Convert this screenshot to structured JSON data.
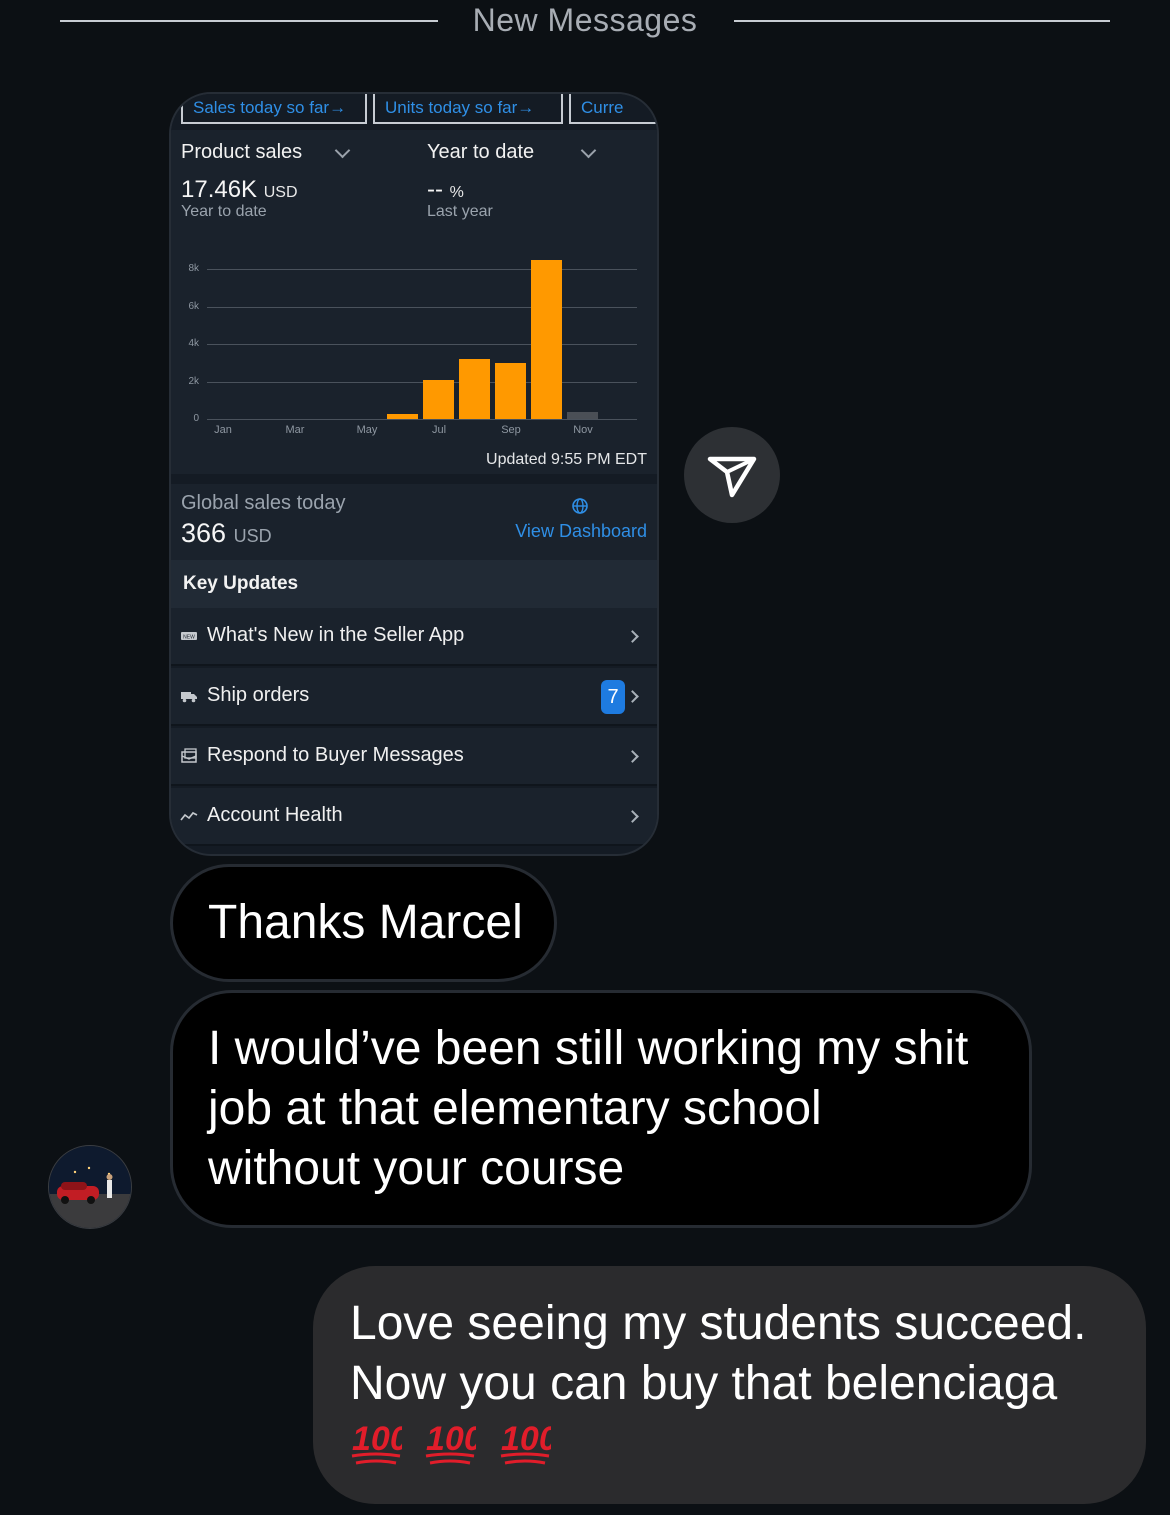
{
  "divider": {
    "label": "New Messages"
  },
  "screenshot": {
    "tabs": [
      "Sales today so far→",
      "Units today so far→",
      "Curre"
    ],
    "metric_selector": "Product sales",
    "period_selector": "Year to date",
    "total": {
      "value": "17.46K",
      "unit": "USD",
      "caption": "Year to date"
    },
    "change": {
      "value": "--",
      "unit": "%",
      "caption": "Last year"
    },
    "chart_data": {
      "type": "bar",
      "title": "",
      "xlabel": "",
      "ylabel": "",
      "ylim": [
        0,
        8000
      ],
      "yticks": [
        "0",
        "2k",
        "4k",
        "6k",
        "8k"
      ],
      "xticks": [
        "Jan",
        "Mar",
        "May",
        "Jul",
        "Sep",
        "Nov"
      ],
      "categories": [
        "Jan",
        "Feb",
        "Mar",
        "Apr",
        "May",
        "Jun",
        "Jul",
        "Aug",
        "Sep",
        "Oct",
        "Nov",
        "Dec"
      ],
      "values": [
        0,
        0,
        0,
        0,
        0,
        250,
        2100,
        3200,
        3000,
        8500,
        366,
        0
      ],
      "colors": {
        "bar": "#ff9900",
        "current_period": "#4a4f56"
      },
      "grid": true
    },
    "updated": "Updated 9:55 PM EDT",
    "global": {
      "label": "Global sales today",
      "value": "366",
      "unit": "USD",
      "link": "View Dashboard"
    },
    "key_updates": {
      "title": "Key Updates",
      "items": [
        {
          "icon": "new-badge-icon",
          "label": "What's New in the Seller App",
          "badge": ""
        },
        {
          "icon": "truck-icon",
          "label": "Ship orders",
          "badge": "7"
        },
        {
          "icon": "message-icon",
          "label": "Respond to Buyer Messages",
          "badge": ""
        },
        {
          "icon": "trend-icon",
          "label": "Account Health",
          "badge": ""
        }
      ]
    }
  },
  "messages": [
    {
      "from": "them",
      "text": "Thanks Marcel"
    },
    {
      "from": "them",
      "lines": [
        "I would’ve been still working my shit",
        "job at that elementary school",
        "without your course"
      ]
    },
    {
      "from": "me",
      "lines": [
        "Love seeing my students succeed.",
        "Now you can buy that belenciaga"
      ],
      "emoji": [
        "💯",
        "💯",
        "💯"
      ]
    }
  ],
  "colors": {
    "accent": "#2f8fe6",
    "bar": "#ff9900",
    "badge": "#1e7be0"
  }
}
